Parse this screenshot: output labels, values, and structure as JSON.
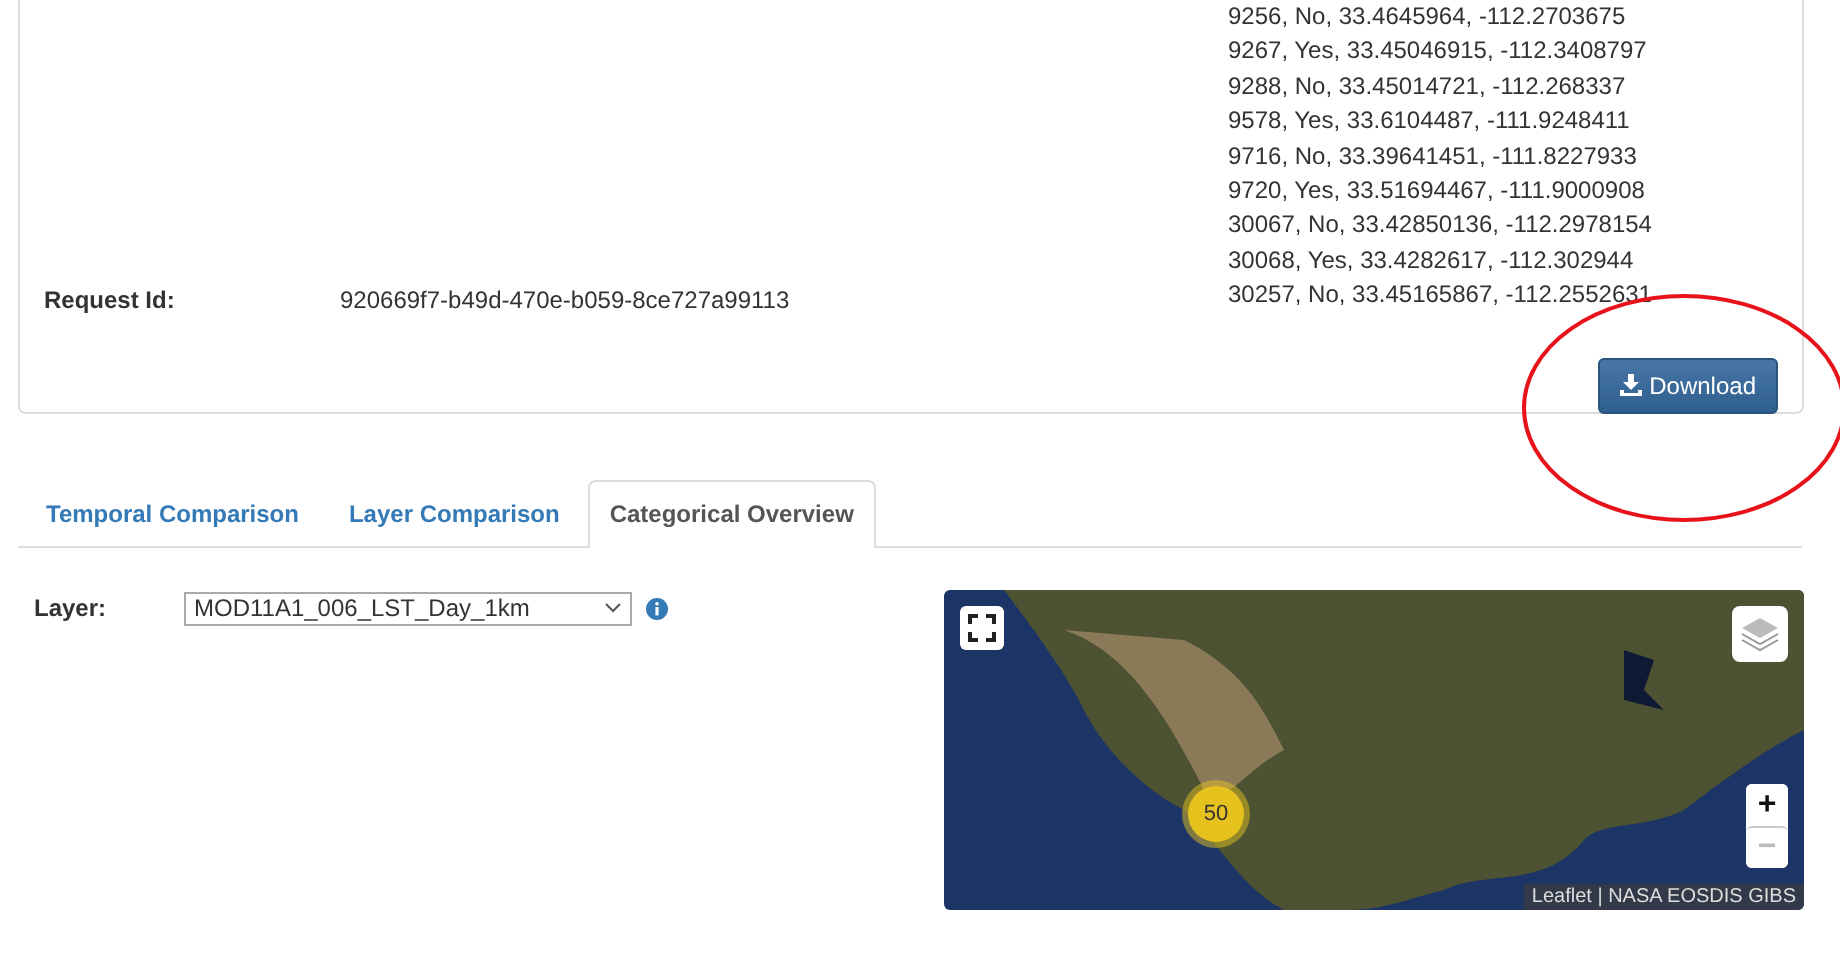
{
  "results": {
    "request_id_label": "Request Id:",
    "request_id": "920669f7-b49d-470e-b059-8ce727a99113",
    "rows": [
      "9256, No, 33.4645964, -112.2703675",
      "9267, Yes, 33.45046915, -112.3408797",
      "9288, No, 33.45014721, -112.268337",
      "9578, Yes, 33.6104487, -111.9248411",
      "9716, No, 33.39641451, -111.8227933",
      "9720, Yes, 33.51694467, -111.9000908",
      "30067, No, 33.42850136, -112.2978154",
      "30068, Yes, 33.4282617, -112.302944",
      "30257, No, 33.45165867, -112.2552631"
    ],
    "download_button": "Download"
  },
  "tabs": [
    {
      "label": "Temporal Comparison",
      "selected": false
    },
    {
      "label": "Layer Comparison",
      "selected": false
    },
    {
      "label": "Categorical Overview",
      "selected": true
    }
  ],
  "layer": {
    "label": "Layer:",
    "value": "MOD11A1_006_LST_Day_1km"
  },
  "map": {
    "cluster_count": "50",
    "zoom_in": "+",
    "zoom_out": "−",
    "attribution": "Leaflet | NASA EOSDIS GIBS"
  }
}
